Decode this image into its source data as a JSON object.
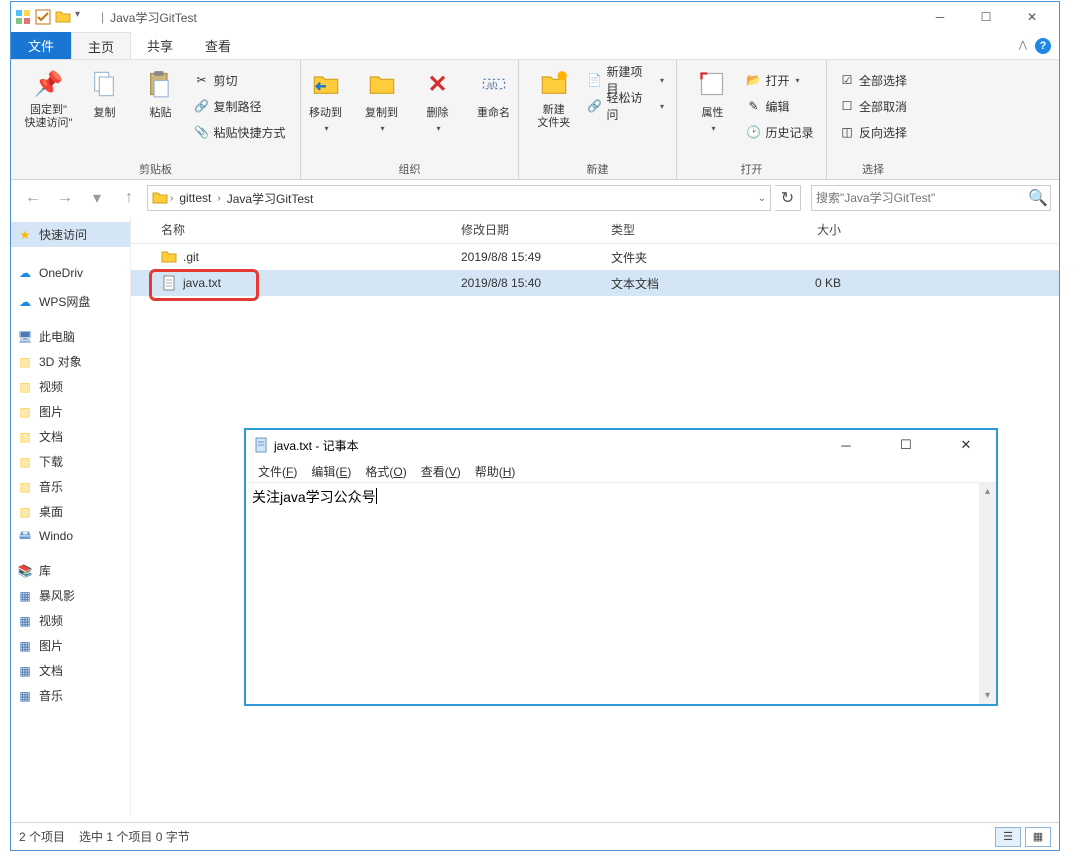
{
  "title": {
    "path_text": "Java学习GitTest"
  },
  "menu": {
    "file": "文件",
    "tabs": [
      "主页",
      "共享",
      "查看"
    ]
  },
  "ribbon": {
    "pin": {
      "label": "固定到\"\n快速访问\""
    },
    "copy": "复制",
    "paste": "粘贴",
    "cut": "剪切",
    "copypath": "复制路径",
    "paste_shortcut": "粘贴快捷方式",
    "group_clipboard": "剪贴板",
    "move_to": "移动到",
    "copy_to": "复制到",
    "delete": "删除",
    "rename": "重命名",
    "group_organize": "组织",
    "new_folder": "新建\n文件夹",
    "new_item": "新建项目",
    "easy_access": "轻松访问",
    "group_new": "新建",
    "properties": "属性",
    "open": "打开",
    "edit": "编辑",
    "history": "历史记录",
    "group_open": "打开",
    "select_all": "全部选择",
    "select_none": "全部取消",
    "invert_sel": "反向选择",
    "group_select": "选择"
  },
  "breadcrumb": {
    "items": [
      "gittest",
      "Java学习GitTest"
    ]
  },
  "search": {
    "placeholder": "搜索\"Java学习GitTest\""
  },
  "sidebar": {
    "quick": "快速访问",
    "onedrive": "OneDriv",
    "wps": "WPS网盘",
    "thispc": "此电脑",
    "thispc_items": [
      "3D 对象",
      "视频",
      "图片",
      "文档",
      "下载",
      "音乐",
      "桌面",
      "Windo"
    ],
    "library": "库",
    "lib_items": [
      "暴风影",
      "视频",
      "图片",
      "文档",
      "音乐"
    ]
  },
  "columns": {
    "name": "名称",
    "date": "修改日期",
    "type": "类型",
    "size": "大小"
  },
  "files": [
    {
      "name": ".git",
      "date": "2019/8/8 15:49",
      "type": "文件夹",
      "size": ""
    },
    {
      "name": "java.txt",
      "date": "2019/8/8 15:40",
      "type": "文本文档",
      "size": "0 KB"
    }
  ],
  "status": {
    "items": "2 个项目",
    "selected": "选中 1 个项目 0 字节"
  },
  "notepad": {
    "title": "java.txt - 记事本",
    "menu": {
      "file": "文件(F)",
      "edit": "编辑(E)",
      "format": "格式(O)",
      "view": "查看(V)",
      "help": "帮助(H)"
    },
    "content": "关注java学习公众号"
  }
}
